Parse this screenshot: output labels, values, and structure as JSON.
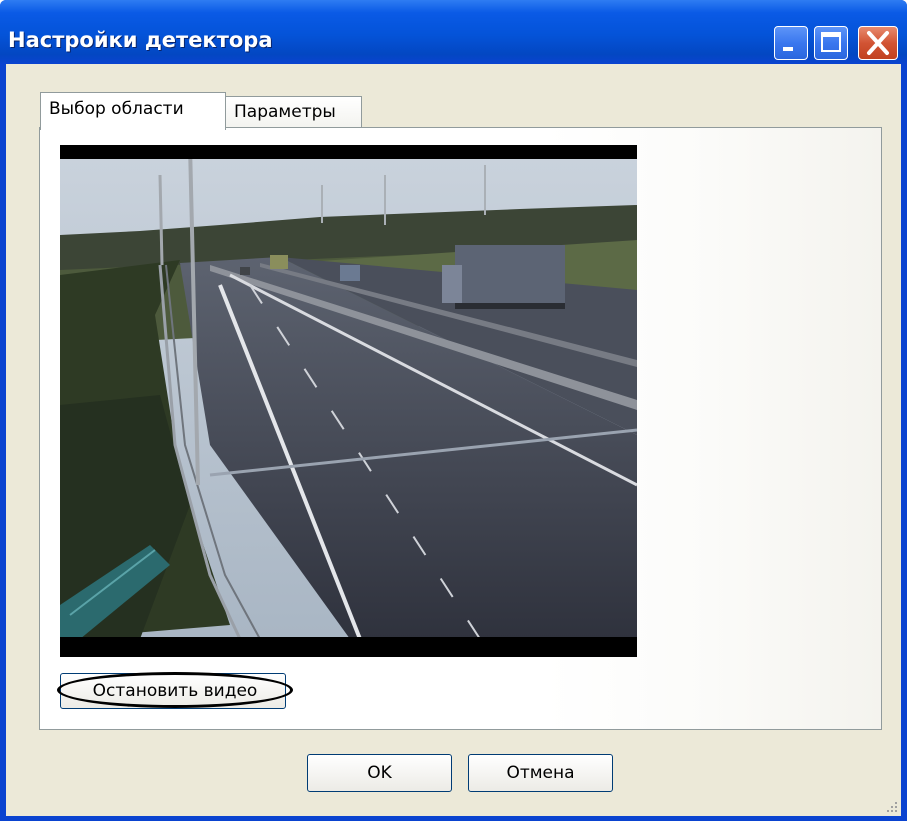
{
  "window": {
    "title": "Настройки детектора"
  },
  "tabs": [
    {
      "label": "Выбор области",
      "active": true
    },
    {
      "label": "Параметры",
      "active": false
    }
  ],
  "video": {
    "stop_label": "Остановить видео"
  },
  "buttons": {
    "ok_label": "OK",
    "cancel_label": "Отмена"
  },
  "colors": {
    "titlebar": "#0453d8",
    "client": "#ece9d8",
    "close": "#d25434"
  }
}
